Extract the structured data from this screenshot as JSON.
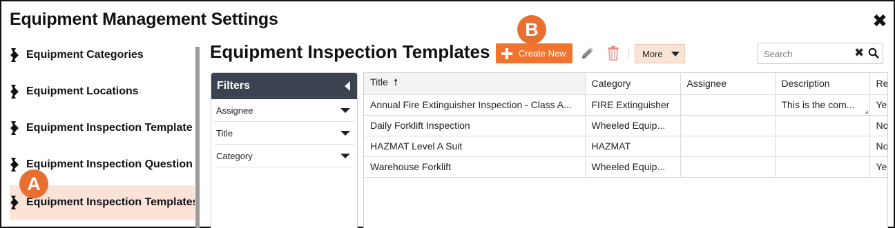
{
  "modal": {
    "title": "Equipment Management Settings",
    "close_icon": "close-icon"
  },
  "sidebar": {
    "items": [
      {
        "label": "Equipment Categories",
        "icon": "gear-icon",
        "active": false
      },
      {
        "label": "Equipment Locations",
        "icon": "gear-icon",
        "active": false
      },
      {
        "label": "Equipment Inspection Template C",
        "icon": "gear-icon",
        "active": false
      },
      {
        "label": "Equipment Inspection Question C",
        "icon": "gear-icon",
        "active": false
      },
      {
        "label": "Equipment Inspection Templates",
        "icon": "gear-icon",
        "active": true
      }
    ]
  },
  "content": {
    "title": "Equipment Inspection Templates"
  },
  "toolbar": {
    "create_label": "Create New",
    "edit_icon": "pencil-icon",
    "delete_icon": "trash-icon",
    "more_label": "More"
  },
  "search": {
    "placeholder": "Search",
    "value": ""
  },
  "filters": {
    "title": "Filters",
    "items": [
      {
        "label": "Assignee"
      },
      {
        "label": "Title"
      },
      {
        "label": "Category"
      }
    ]
  },
  "grid": {
    "columns": [
      "Title",
      "Category",
      "Assignee",
      "Description",
      "Re"
    ],
    "sort": {
      "column": "Title",
      "direction": "ascending"
    },
    "rows": [
      [
        "Annual Fire Extinguisher Inspection - Class A...",
        "FIRE Extinguisher",
        "",
        "This is the com...",
        "Ye"
      ],
      [
        "Daily Forklift Inspection",
        "Wheeled Equip...",
        "",
        "",
        "No"
      ],
      [
        "HAZMAT Level A Suit",
        "HAZMAT",
        "",
        "",
        "No"
      ],
      [
        "Warehouse Forklift",
        "Wheeled Equip...",
        "",
        "",
        "Ye"
      ]
    ]
  },
  "callouts": {
    "a": "A",
    "b": "B"
  },
  "colors": {
    "accent": "#f0742e",
    "callout": "#e86f2f",
    "active_bg": "#fbe3d8",
    "filters_header": "#3c4350"
  }
}
